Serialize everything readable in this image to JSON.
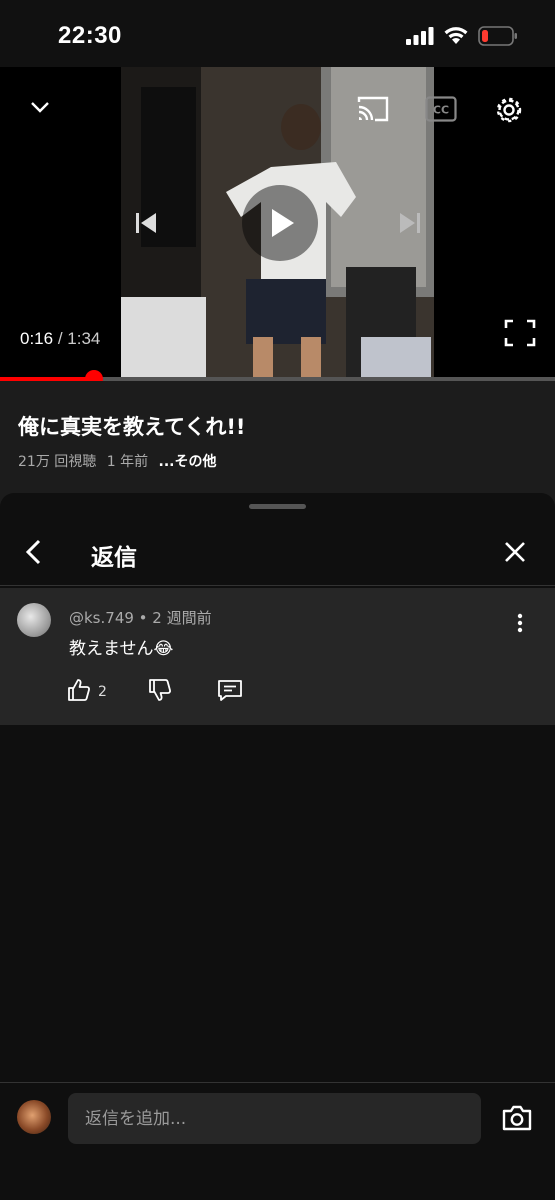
{
  "status_bar": {
    "time": "22:30"
  },
  "player": {
    "current_time": "0:16",
    "separator": " / ",
    "duration": "1:34",
    "progress_fraction": 0.17
  },
  "video": {
    "title": "俺に真実を教えてくれ!!",
    "views": "21万 回視聴",
    "age": "1 年前",
    "more": "...その他"
  },
  "replies_panel": {
    "title": "返信",
    "comment": {
      "author": "@ks.749",
      "dot": " • ",
      "time": "2 週間前",
      "text": "教えません😂",
      "like_count": "2"
    }
  },
  "reply_bar": {
    "placeholder": "返信を追加..."
  },
  "colors": {
    "accent": "#ff0000",
    "background": "#0f0f0f",
    "comment_bg": "#262626",
    "battery_low": "#ff3b30"
  }
}
